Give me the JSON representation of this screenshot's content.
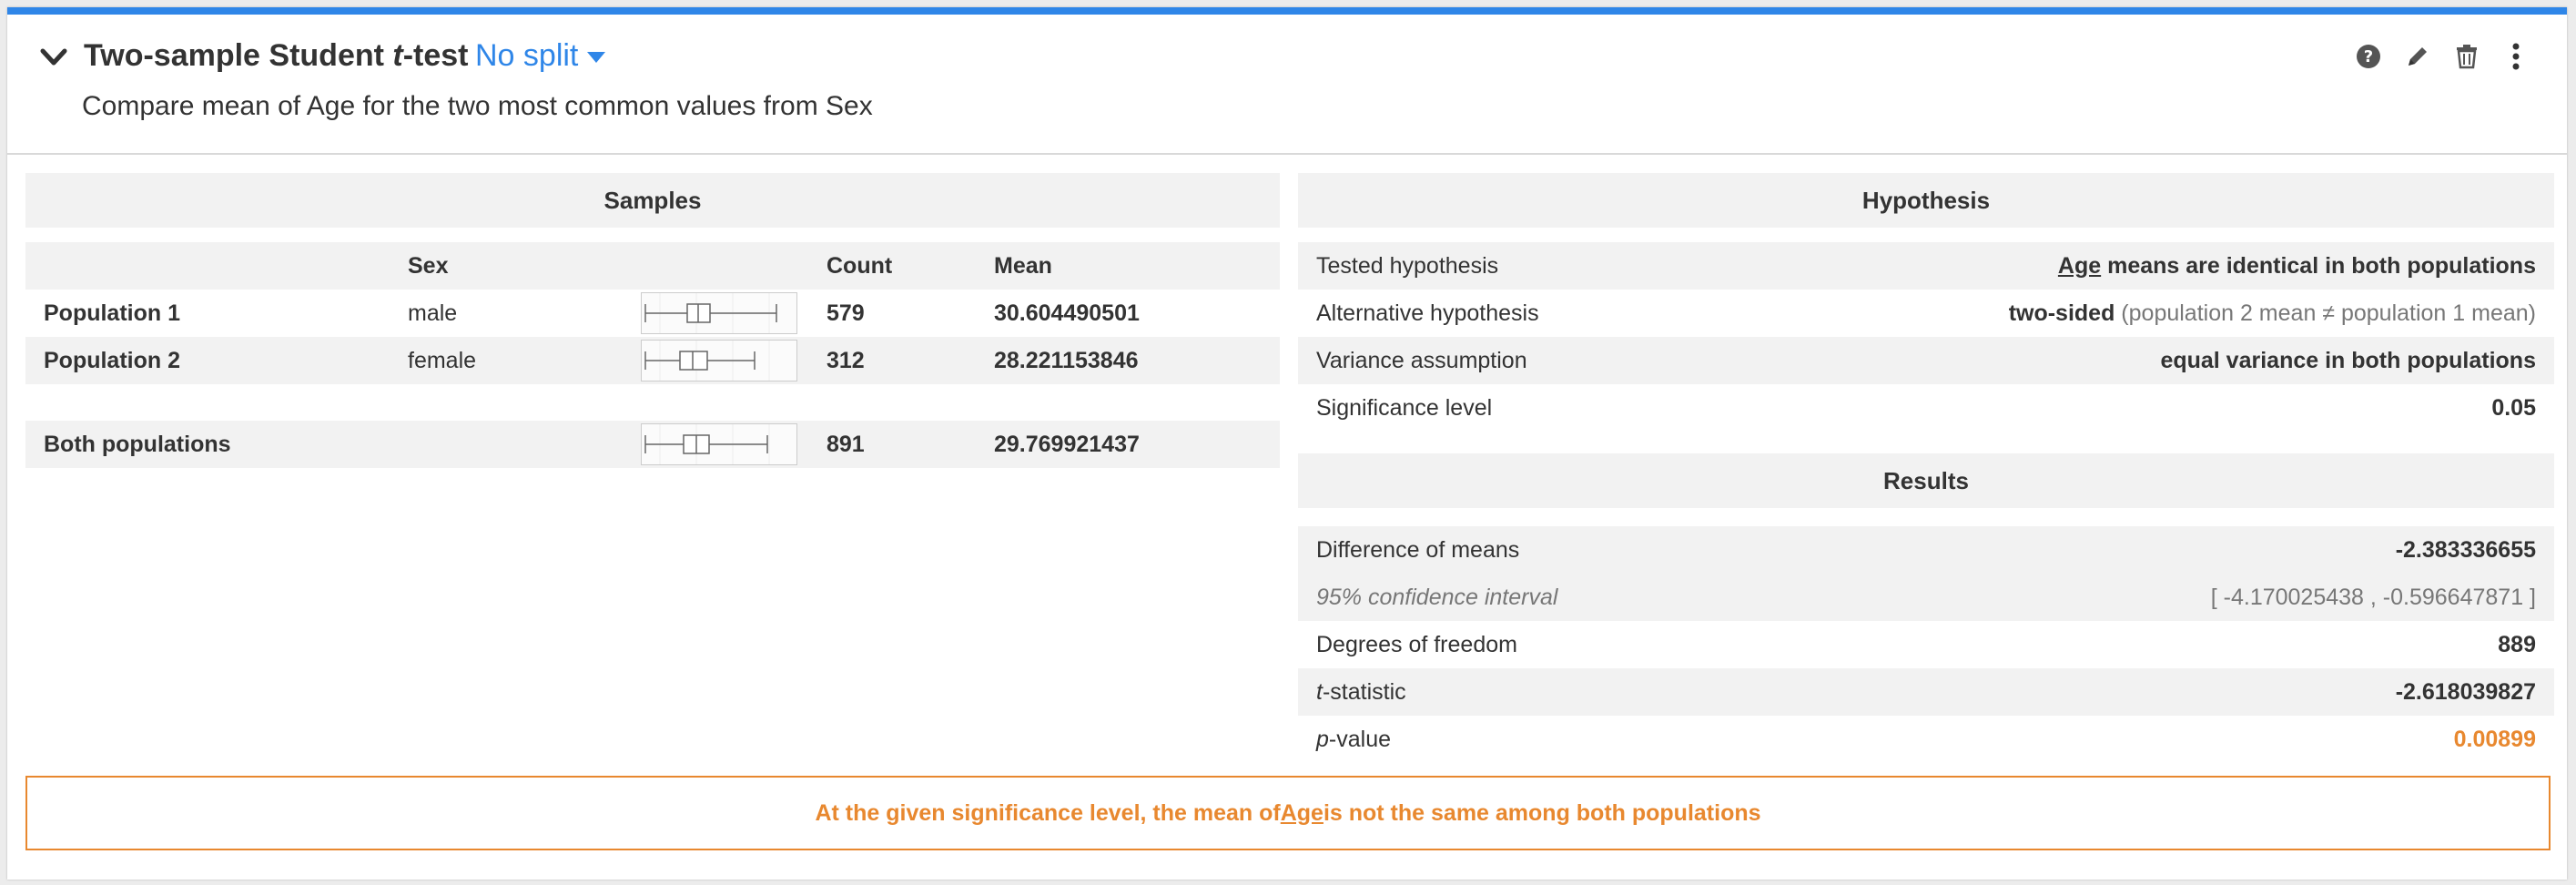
{
  "header": {
    "title_prefix": "Two-sample Student ",
    "title_t": "t",
    "title_suffix": "-test",
    "split_label": "No split",
    "subtitle": "Compare mean of Age for the two most common values from Sex",
    "actions": [
      "help-icon",
      "edit-icon",
      "trash-icon",
      "more-vertical-icon"
    ]
  },
  "samples": {
    "section_title": "Samples",
    "columns": [
      "",
      "Sex",
      "",
      "Count",
      "Mean"
    ],
    "rows": [
      {
        "label": "Population 1",
        "sex": "male",
        "count": "579",
        "mean": "30.604490501"
      },
      {
        "label": "Population 2",
        "sex": "female",
        "count": "312",
        "mean": "28.221153846"
      }
    ],
    "total": {
      "label": "Both populations",
      "count": "891",
      "mean": "29.769921437"
    }
  },
  "hypothesis": {
    "section_title": "Hypothesis",
    "tested_label": "Tested hypothesis",
    "tested_var": "Age",
    "tested_value": " means are identical in both populations",
    "alt_label": "Alternative hypothesis",
    "alt_value": "two-sided",
    "alt_detail": " (population 2 mean ≠ population 1 mean)",
    "variance_label": "Variance assumption",
    "variance_value": "equal variance in both populations",
    "significance_label": "Significance level",
    "significance_value": "0.05"
  },
  "results": {
    "section_title": "Results",
    "diff_label": "Difference of means",
    "diff_value": "-2.383336655",
    "ci_label": "95% confidence interval",
    "ci_value": "[ -4.170025438 , -0.596647871 ]",
    "dof_label": "Degrees of freedom",
    "dof_value": "889",
    "tstat_t": "t",
    "tstat_label": "-statistic",
    "tstat_value": "-2.618039827",
    "pvalue_p": "p",
    "pvalue_label": "-value",
    "pvalue_value": "0.00899"
  },
  "conclusion": {
    "prefix": "At the given significance level, the mean of ",
    "var": "Age",
    "suffix": " is not the same among both populations"
  },
  "colors": {
    "accent": "#2f86e8",
    "warning": "#e8882f"
  }
}
